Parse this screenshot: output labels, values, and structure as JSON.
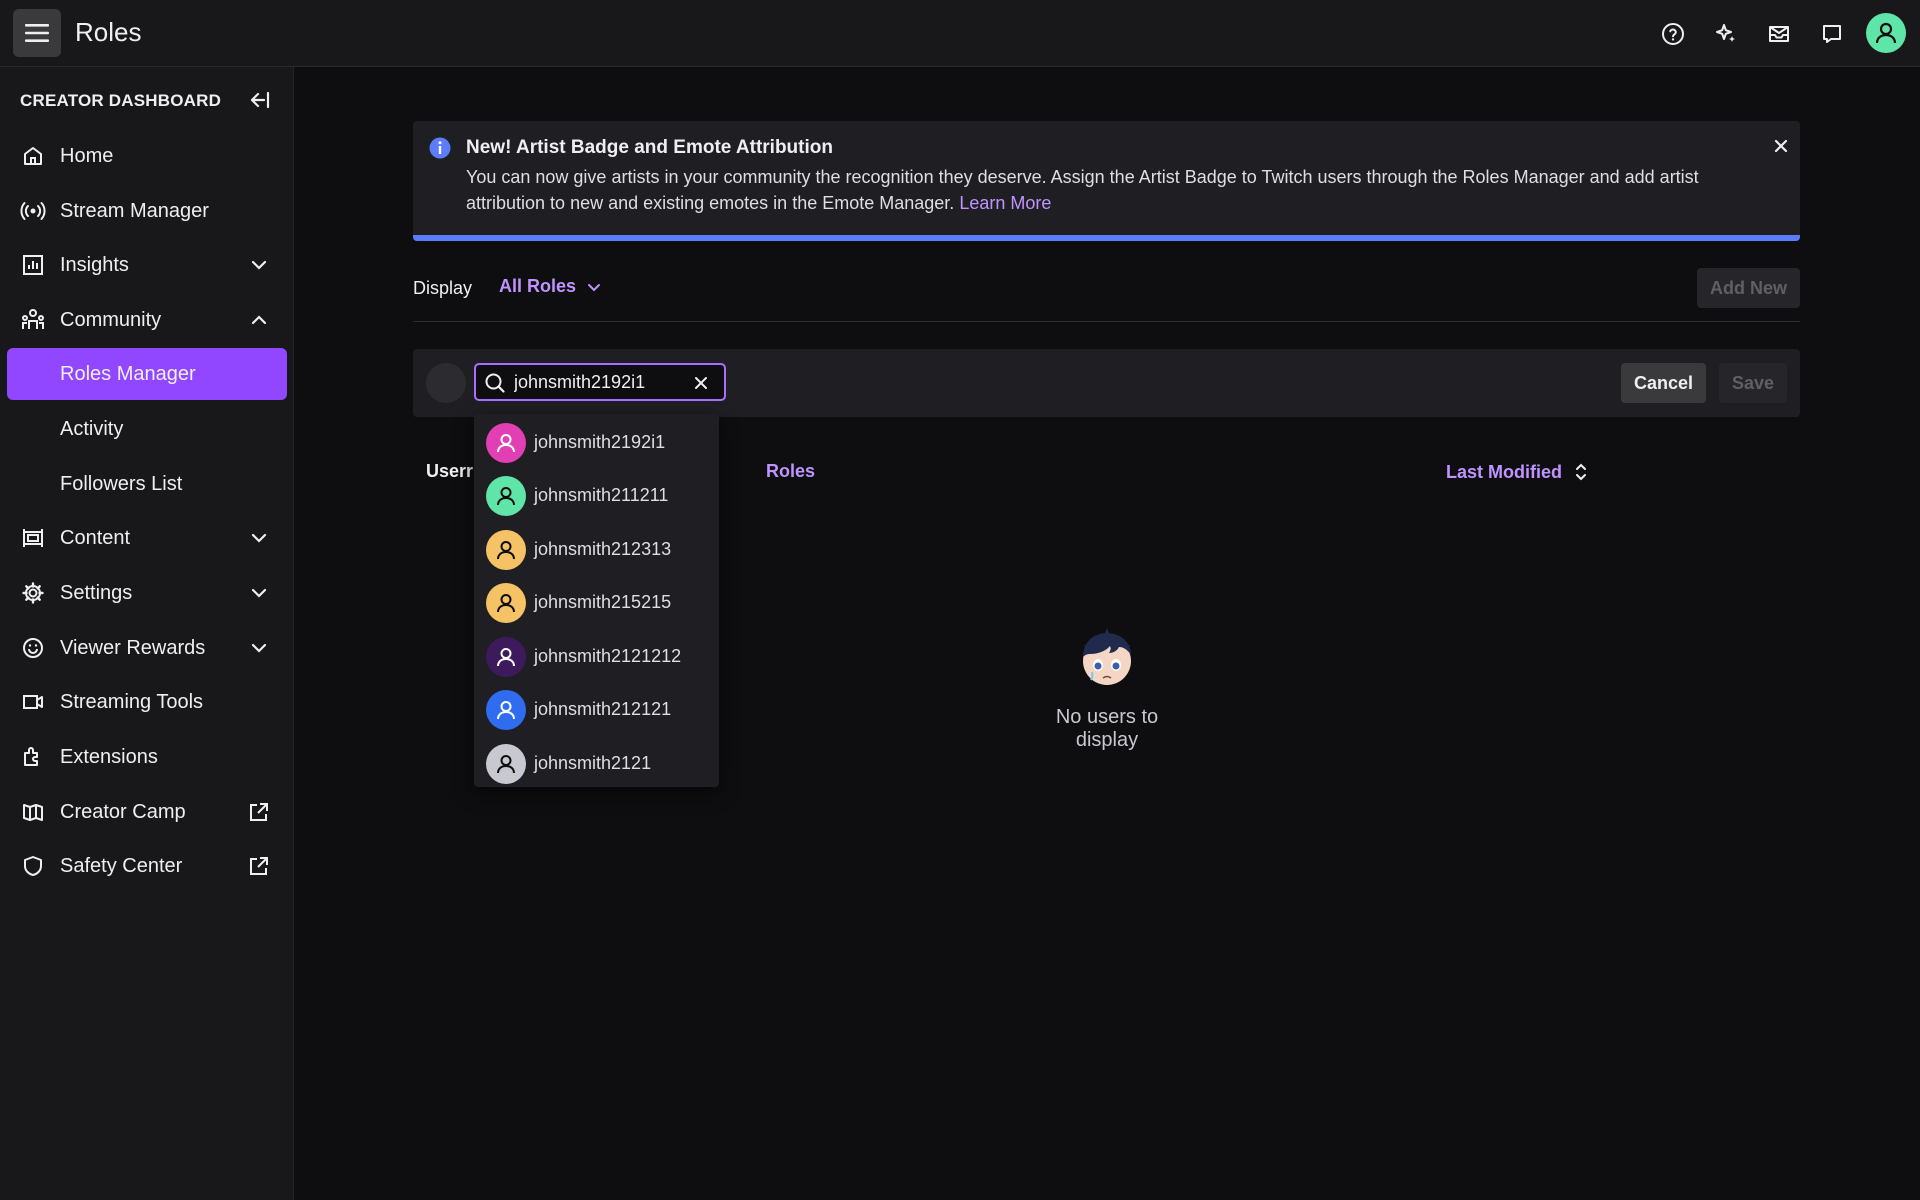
{
  "topbar": {
    "title": "Roles",
    "icons": [
      "help-icon",
      "sparkle-icon",
      "inbox-icon",
      "whispers-icon",
      "user-avatar"
    ]
  },
  "sidebar": {
    "header": "CREATOR DASHBOARD",
    "items": [
      {
        "label": "Home",
        "icon": "home-icon"
      },
      {
        "label": "Stream Manager",
        "icon": "broadcast-icon"
      },
      {
        "label": "Insights",
        "icon": "insights-icon",
        "chevron": "down"
      },
      {
        "label": "Community",
        "icon": "community-icon",
        "chevron": "up"
      },
      {
        "label": "Roles Manager",
        "sub": true,
        "active": true
      },
      {
        "label": "Activity",
        "sub": true
      },
      {
        "label": "Followers List",
        "sub": true
      },
      {
        "label": "Content",
        "icon": "content-icon",
        "chevron": "down"
      },
      {
        "label": "Settings",
        "icon": "settings-icon",
        "chevron": "down"
      },
      {
        "label": "Viewer Rewards",
        "icon": "rewards-icon",
        "chevron": "down"
      },
      {
        "label": "Streaming Tools",
        "icon": "camera-icon"
      },
      {
        "label": "Extensions",
        "icon": "extensions-icon"
      },
      {
        "label": "Creator Camp",
        "icon": "book-icon",
        "external": true
      },
      {
        "label": "Safety Center",
        "icon": "shield-icon",
        "external": true
      }
    ]
  },
  "banner": {
    "title": "New! Artist Badge and Emote Attribution",
    "text": "You can now give artists in your community the recognition they deserve. Assign the Artist Badge to Twitch users through the Roles Manager and add artist attribution to new and existing emotes in the Emote Manager.",
    "link": "Learn More"
  },
  "filter": {
    "display_label": "Display",
    "roles_value": "All Roles",
    "add_new": "Add New"
  },
  "edit": {
    "search_value": "johnsmith2192i1",
    "cancel": "Cancel",
    "save": "Save"
  },
  "table": {
    "col_user": "Userr",
    "col_roles": "Roles",
    "col_modified": "Last Modified",
    "empty": "No users to display"
  },
  "dropdown": [
    {
      "name": "johnsmith2192i1",
      "color": "#e23fb5"
    },
    {
      "name": "johnsmith211211",
      "color": "#5fe5a8"
    },
    {
      "name": "johnsmith212313",
      "color": "#f5c265"
    },
    {
      "name": "johnsmith215215",
      "color": "#f5c265"
    },
    {
      "name": "johnsmith2121212",
      "color": "#3d1a5c"
    },
    {
      "name": "johnsmith212121",
      "color": "#2f6cf0"
    },
    {
      "name": "johnsmith2121",
      "color": "#c8c8d0"
    }
  ],
  "colors": {
    "accent": "#9147ff",
    "link": "#bf94ff",
    "banner_bar": "#5c7cfa"
  }
}
